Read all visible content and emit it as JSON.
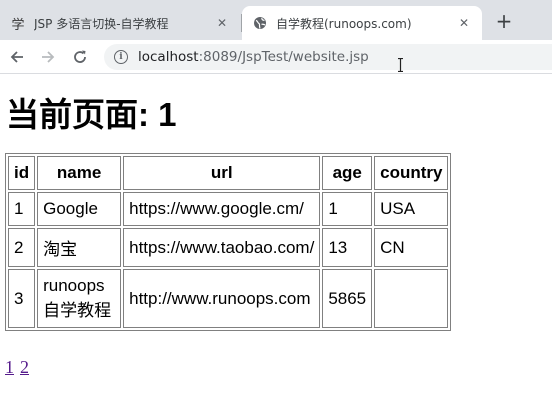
{
  "browser": {
    "tabs": [
      {
        "favicon": "学",
        "title": "JSP 多语言切换-自学教程",
        "close": "✕",
        "active": false
      },
      {
        "favicon": "globe-icon",
        "title": "自学教程(runoops.com)",
        "close": "✕",
        "active": true
      }
    ],
    "new_tab": "+",
    "address": {
      "host": "localhost",
      "path": ":8089/JspTest/website.jsp"
    }
  },
  "page": {
    "heading": "当前页面: 1",
    "table": {
      "headers": [
        "id",
        "name",
        "url",
        "age",
        "country"
      ],
      "rows": [
        [
          "1",
          "Google",
          "https://www.google.cm/",
          "1",
          "USA"
        ],
        [
          "2",
          "淘宝",
          "https://www.taobao.com/",
          "13",
          "CN"
        ],
        [
          "3",
          "runoops自学教程",
          "http://www.runoops.com",
          "5865",
          ""
        ]
      ]
    },
    "pagination": [
      "1",
      "2"
    ]
  }
}
